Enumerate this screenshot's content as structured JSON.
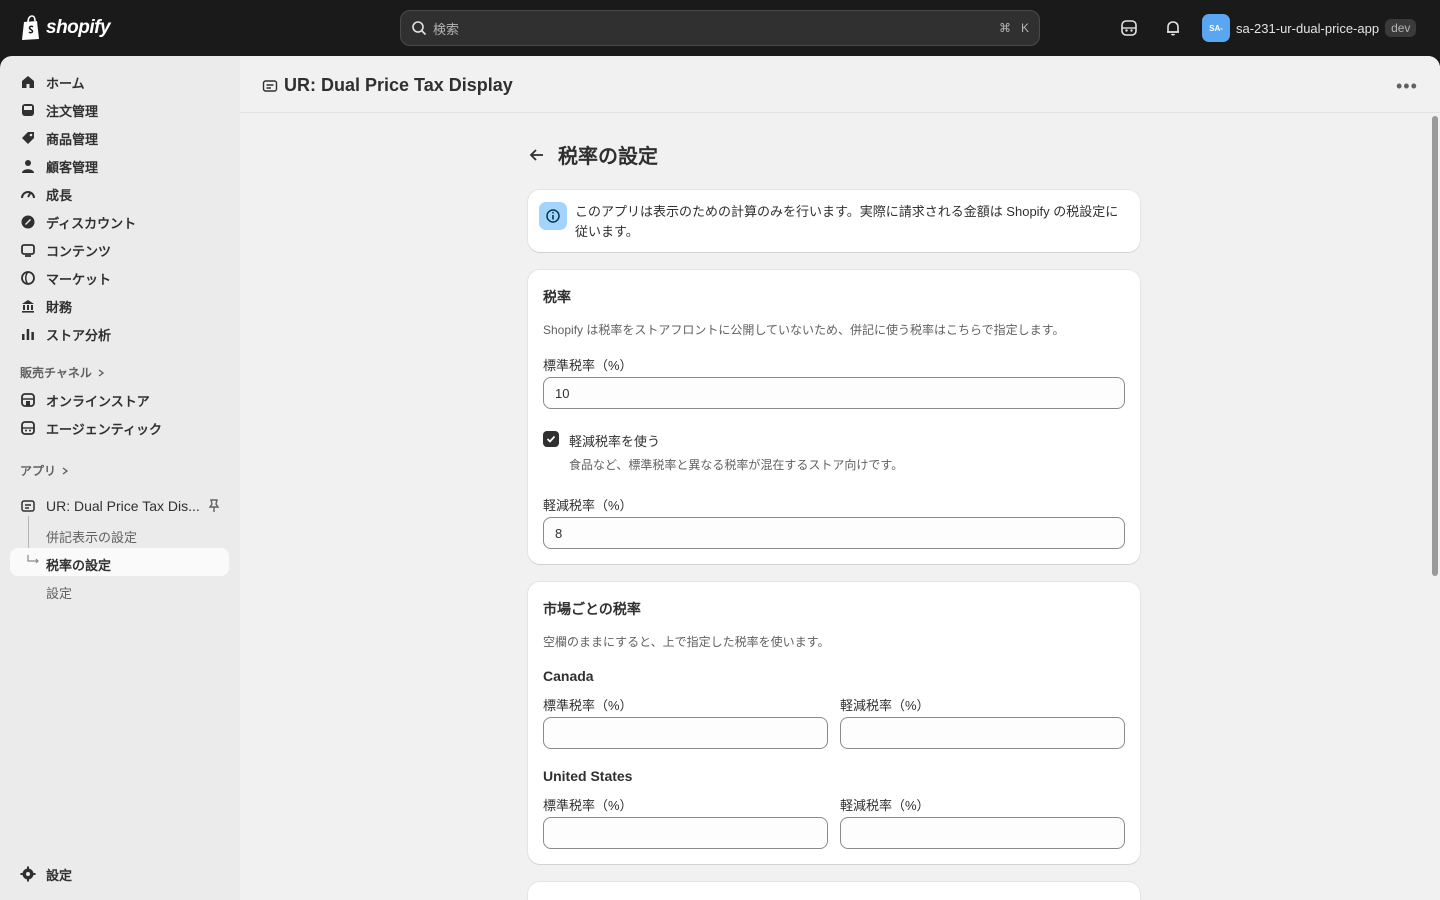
{
  "topbar": {
    "logo_text": "shopify",
    "search_placeholder": "検索",
    "search_shortcut_cmd": "⌘",
    "search_shortcut_key": "K",
    "store_avatar": "SA-",
    "store_name": "sa-231-ur-dual-price-app",
    "store_badge": "dev"
  },
  "sidebar": {
    "items": [
      {
        "label": "ホーム",
        "icon": "home-icon"
      },
      {
        "label": "注文管理",
        "icon": "orders-icon"
      },
      {
        "label": "商品管理",
        "icon": "tag-icon"
      },
      {
        "label": "顧客管理",
        "icon": "person-icon"
      },
      {
        "label": "成長",
        "icon": "gauge-icon"
      },
      {
        "label": "ディスカウント",
        "icon": "discount-icon"
      },
      {
        "label": "コンテンツ",
        "icon": "content-icon"
      },
      {
        "label": "マーケット",
        "icon": "globe-icon"
      },
      {
        "label": "財務",
        "icon": "bank-icon"
      },
      {
        "label": "ストア分析",
        "icon": "chart-icon"
      }
    ],
    "sales_channels_label": "販売チャネル",
    "channels": [
      {
        "label": "オンラインストア",
        "icon": "store-icon"
      },
      {
        "label": "エージェンティック",
        "icon": "agentic-icon"
      }
    ],
    "apps_label": "アプリ",
    "app_name": "UR: Dual Price Tax Dis...",
    "app_subitems": [
      "併記表示の設定",
      "税率の設定",
      "設定"
    ],
    "settings_label": "設定"
  },
  "appbar": {
    "title": "UR: Dual Price Tax Display",
    "more": "•••"
  },
  "page": {
    "title": "税率の設定",
    "banner_text": "このアプリは表示のための計算のみを行います。実際に請求される金額は Shopify の税設定に従います。",
    "tax_card": {
      "heading": "税率",
      "description": "Shopify は税率をストアフロントに公開していないため、併記に使う税率はこちらで指定します。",
      "standard_label": "標準税率（%）",
      "standard_value": "10",
      "reduced_checkbox_label": "軽減税率を使う",
      "reduced_checkbox_checked": true,
      "reduced_checkbox_help": "食品など、標準税率と異なる税率が混在するストア向けです。",
      "reduced_label": "軽減税率（%）",
      "reduced_value": "8"
    },
    "market_card": {
      "heading": "市場ごとの税率",
      "description": "空欄のままにすると、上で指定した税率を使います。",
      "markets": [
        {
          "name": "Canada",
          "standard_label": "標準税率（%）",
          "reduced_label": "軽減税率（%）",
          "standard_value": "",
          "reduced_value": ""
        },
        {
          "name": "United States",
          "standard_label": "標準税率（%）",
          "reduced_label": "軽減税率（%）",
          "standard_value": "",
          "reduced_value": ""
        }
      ]
    }
  }
}
